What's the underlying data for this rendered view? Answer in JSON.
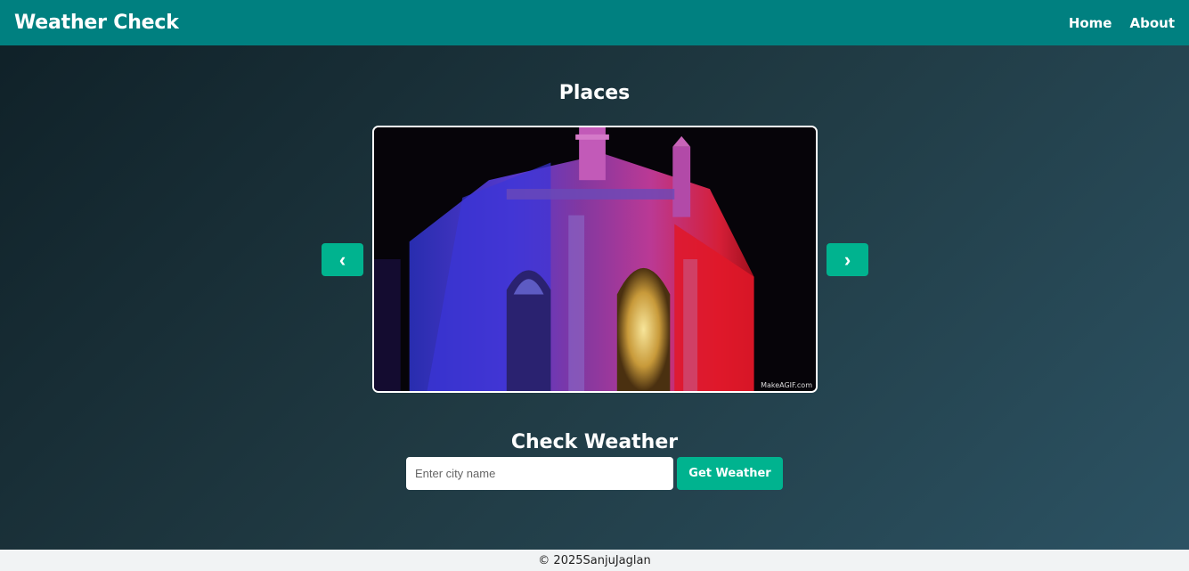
{
  "navbar": {
    "brand": "Weather Check",
    "links": [
      "Home",
      "About"
    ]
  },
  "places": {
    "title": "Places",
    "prev_icon": "chevron-left-icon",
    "next_icon": "chevron-right-icon",
    "prev_label": "‹",
    "next_label": "›",
    "image_watermark": "MakeAGIF.com"
  },
  "weather": {
    "title": "Check Weather",
    "input_placeholder": "Enter city name",
    "input_value": "",
    "button_label": "Get Weather"
  },
  "footer": {
    "text": "© 2025SanjuJaglan"
  },
  "colors": {
    "navbar": "#008080",
    "accent": "#00b38f",
    "footer_bg": "#f1f3f4"
  }
}
